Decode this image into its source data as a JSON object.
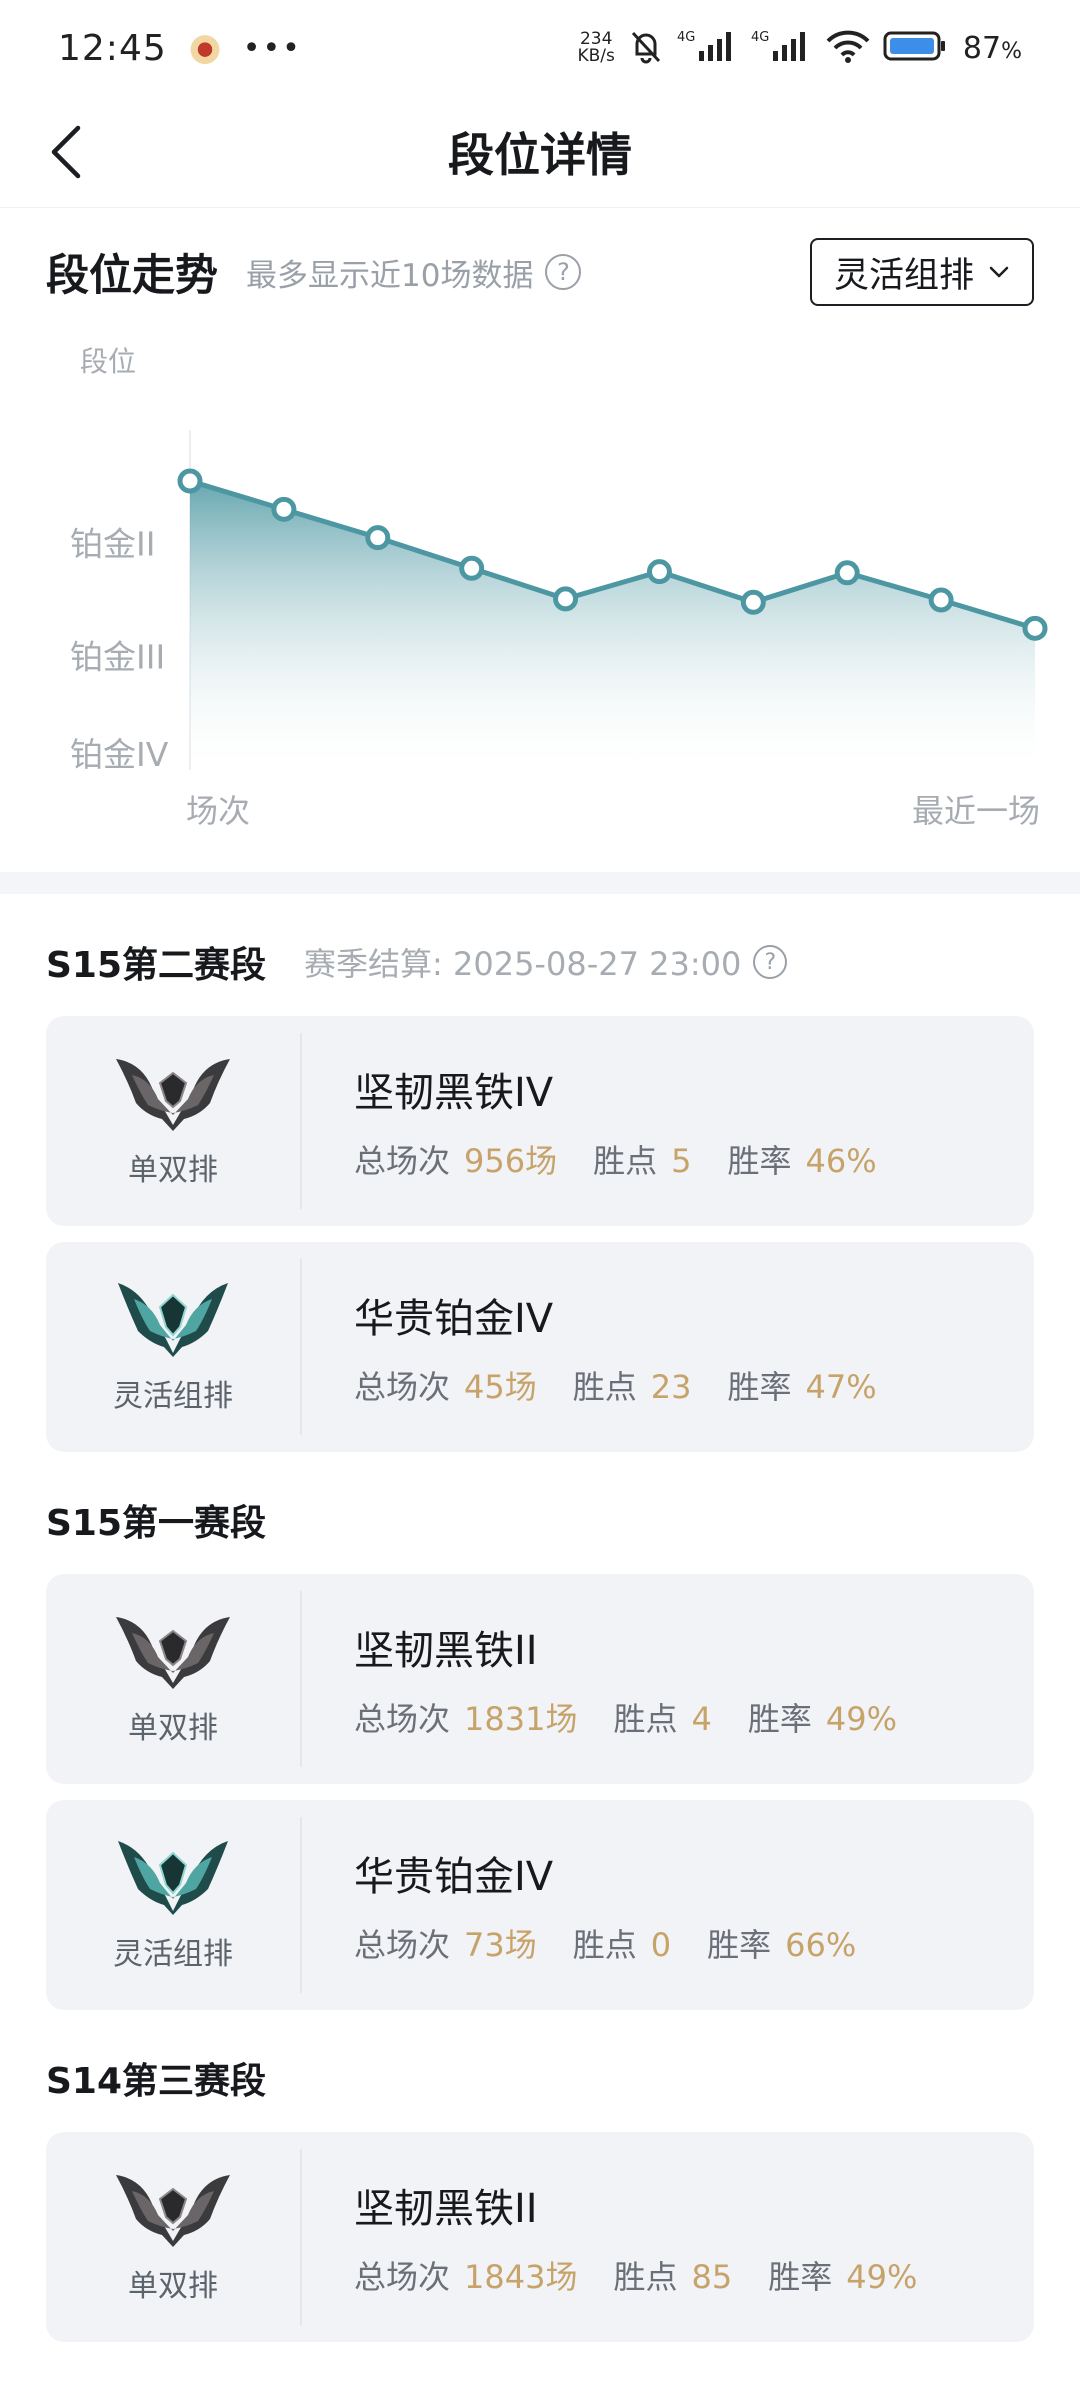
{
  "status_bar": {
    "time": "12:45",
    "more": "•••",
    "net_speed_value": "234",
    "net_speed_unit": "KB/s",
    "battery_percent": "87",
    "battery_unit": "%"
  },
  "nav": {
    "title": "段位详情"
  },
  "trend": {
    "title": "段位走势",
    "subtitle": "最多显示近10场数据",
    "help": "?",
    "mode_select": "灵活组排"
  },
  "chart_data": {
    "type": "area",
    "ylabel": "段位",
    "y_ticks": [
      "铂金IV",
      "铂金III",
      "铂金II"
    ],
    "x_start_label": "场次",
    "x_end_label": "最近一场",
    "series": [
      {
        "values": [
          2.55,
          2.3,
          2.05,
          1.78,
          1.51,
          1.75,
          1.48,
          1.74,
          1.5,
          1.25
        ]
      }
    ],
    "ylim": [
      0,
      3
    ],
    "colors": {
      "line": "#4c97a2",
      "fill_top": "#4c97a2",
      "fill_bottom": "#ffffff"
    },
    "grid": false
  },
  "seasons": [
    {
      "name": "S15第二赛段",
      "settlement": "赛季结算: 2025-08-27 23:00",
      "help": "?",
      "ranks": [
        {
          "queue": "单双排",
          "tier": "坚韧黑铁IV",
          "games_label": "总场次",
          "games": "956场",
          "lp_label": "胜点",
          "lp": "5",
          "wr_label": "胜率",
          "wr": "46%",
          "emblem": "iron-emblem-icon"
        },
        {
          "queue": "灵活组排",
          "tier": "华贵铂金IV",
          "games_label": "总场次",
          "games": "45场",
          "lp_label": "胜点",
          "lp": "23",
          "wr_label": "胜率",
          "wr": "47%",
          "emblem": "platinum-emblem-icon"
        }
      ]
    },
    {
      "name": "S15第一赛段",
      "settlement": "",
      "ranks": [
        {
          "queue": "单双排",
          "tier": "坚韧黑铁II",
          "games_label": "总场次",
          "games": "1831场",
          "lp_label": "胜点",
          "lp": "4",
          "wr_label": "胜率",
          "wr": "49%",
          "emblem": "iron-emblem-icon"
        },
        {
          "queue": "灵活组排",
          "tier": "华贵铂金IV",
          "games_label": "总场次",
          "games": "73场",
          "lp_label": "胜点",
          "lp": "0",
          "wr_label": "胜率",
          "wr": "66%",
          "emblem": "platinum-emblem-icon"
        }
      ]
    },
    {
      "name": "S14第三赛段",
      "settlement": "",
      "ranks": [
        {
          "queue": "单双排",
          "tier": "坚韧黑铁II",
          "games_label": "总场次",
          "games": "1843场",
          "lp_label": "胜点",
          "lp": "85",
          "wr_label": "胜率",
          "wr": "49%",
          "emblem": "iron-emblem-icon"
        }
      ]
    }
  ]
}
